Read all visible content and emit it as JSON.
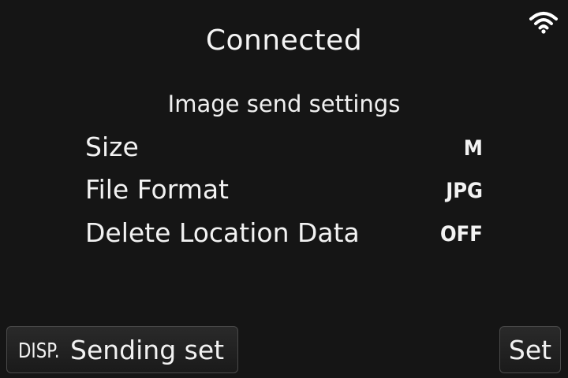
{
  "status": {
    "title": "Connected",
    "icon": "wifi-icon"
  },
  "settings": {
    "title": "Image send settings",
    "rows": [
      {
        "label": "Size",
        "value": "M"
      },
      {
        "label": "File Format",
        "value": "JPG"
      },
      {
        "label": "Delete Location Data",
        "value": "OFF"
      }
    ]
  },
  "footer": {
    "disp_key": "DISP.",
    "disp_label": "Sending set",
    "set_label": "Set"
  },
  "colors": {
    "background": "#151515",
    "text": "#f2f2f2",
    "button_border": "#4a4a4a"
  }
}
